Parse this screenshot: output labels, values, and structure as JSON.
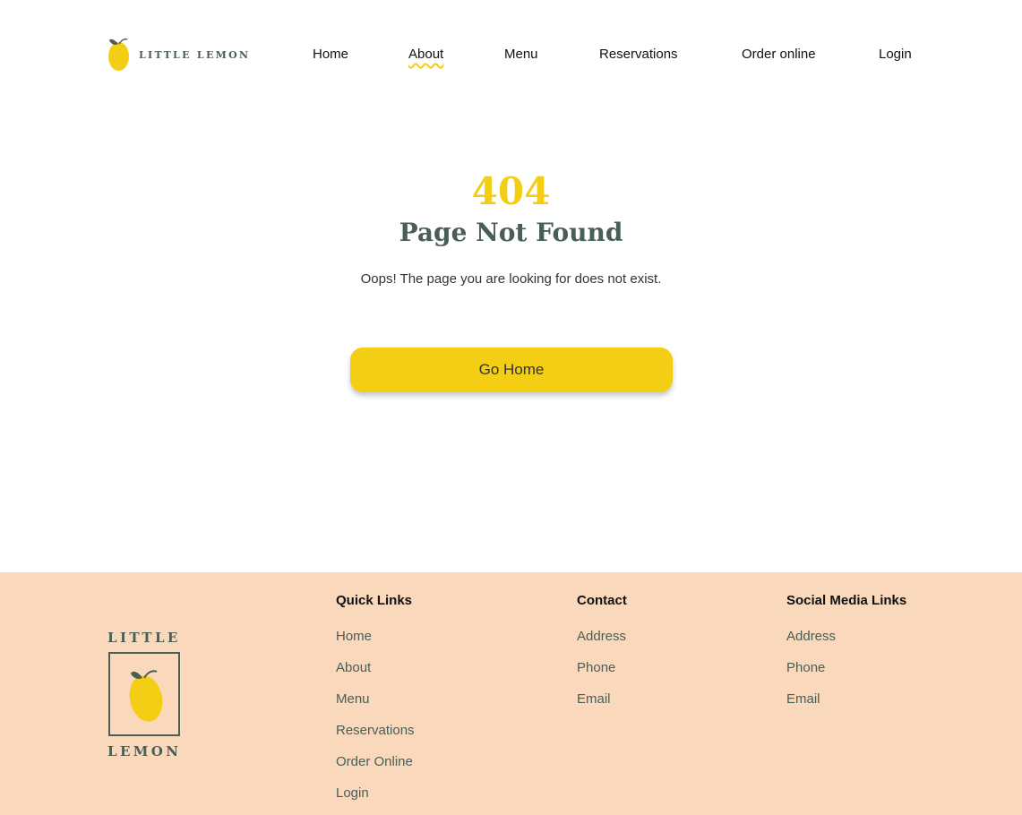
{
  "header": {
    "brand": "LITTLE LEMON",
    "nav": [
      "Home",
      "About",
      "Menu",
      "Reservations",
      "Order online",
      "Login"
    ],
    "active_nav": "About"
  },
  "main": {
    "code": "404",
    "title": "Page Not Found",
    "message": "Oops! The page you are looking for does not exist.",
    "button_label": "Go Home"
  },
  "footer": {
    "logo_top": "LITTLE",
    "logo_bottom": "LEMON",
    "quick_links": {
      "title": "Quick Links",
      "items": [
        "Home",
        "About",
        "Menu",
        "Reservations",
        "Order Online",
        "Login"
      ]
    },
    "contact": {
      "title": "Contact",
      "items": [
        "Address",
        "Phone",
        "Email"
      ]
    },
    "social": {
      "title": "Social Media Links",
      "items": [
        "Address",
        "Phone",
        "Email"
      ]
    }
  },
  "colors": {
    "brand_yellow": "#f4ce14",
    "brand_green": "#495e57",
    "footer_bg": "#fad8bb"
  },
  "icons": {
    "logo": "lemon-icon"
  }
}
